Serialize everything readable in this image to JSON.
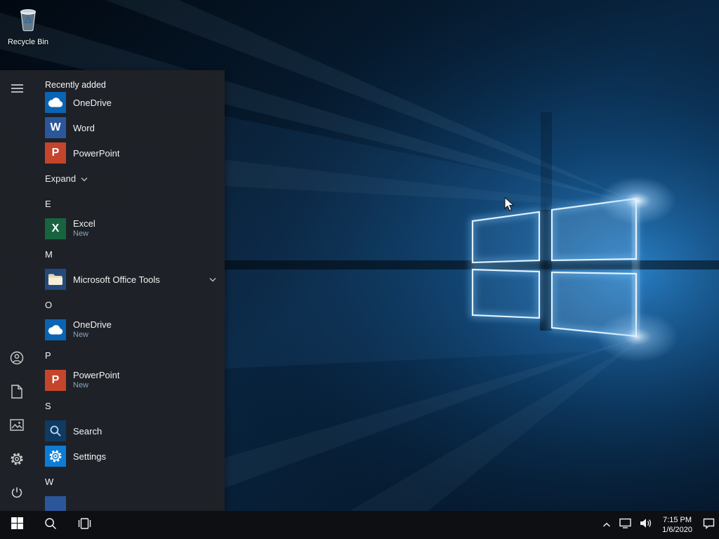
{
  "desktop": {
    "recycle_bin_label": "Recycle Bin"
  },
  "start_menu": {
    "recently_added_header": "Recently added",
    "recent_apps": [
      {
        "label": "OneDrive",
        "icon": "onedrive-icon"
      },
      {
        "label": "Word",
        "icon": "word-icon",
        "letter": "W"
      },
      {
        "label": "PowerPoint",
        "icon": "powerpoint-icon",
        "letter": "P"
      }
    ],
    "expand_label": "Expand",
    "letters": {
      "e": "E",
      "m": "M",
      "o": "O",
      "p": "P",
      "s": "S",
      "w": "W"
    },
    "apps": {
      "excel": {
        "label": "Excel",
        "badge": "New",
        "letter": "X",
        "icon": "excel-icon"
      },
      "office_tools": {
        "label": "Microsoft Office Tools",
        "icon": "folder-icon"
      },
      "onedrive": {
        "label": "OneDrive",
        "badge": "New",
        "icon": "onedrive-icon"
      },
      "powerpoint": {
        "label": "PowerPoint",
        "badge": "New",
        "letter": "P",
        "icon": "powerpoint-icon"
      },
      "search": {
        "label": "Search",
        "icon": "search-app-icon"
      },
      "settings": {
        "label": "Settings",
        "icon": "settings-gear-icon"
      }
    },
    "rail_icons": [
      "hamburger-icon",
      "user-icon",
      "documents-icon",
      "pictures-icon",
      "gear-icon",
      "power-icon"
    ]
  },
  "taskbar": {
    "time": "7:15 PM",
    "date": "1/6/2020",
    "icons": [
      "windows-start-icon",
      "search-icon",
      "task-view-icon",
      "chevron-up-icon",
      "network-icon",
      "volume-icon",
      "action-center-icon"
    ]
  },
  "colors": {
    "accent_blue": "#0078d7",
    "word_blue": "#2b579a",
    "powerpoint_red": "#c4452c",
    "excel_green": "#17643f",
    "onedrive_blue": "#0a64b4",
    "menu_background": "#1f2227",
    "taskbar_background": "#0d0f13",
    "badge_text": "#8aa3bd"
  }
}
